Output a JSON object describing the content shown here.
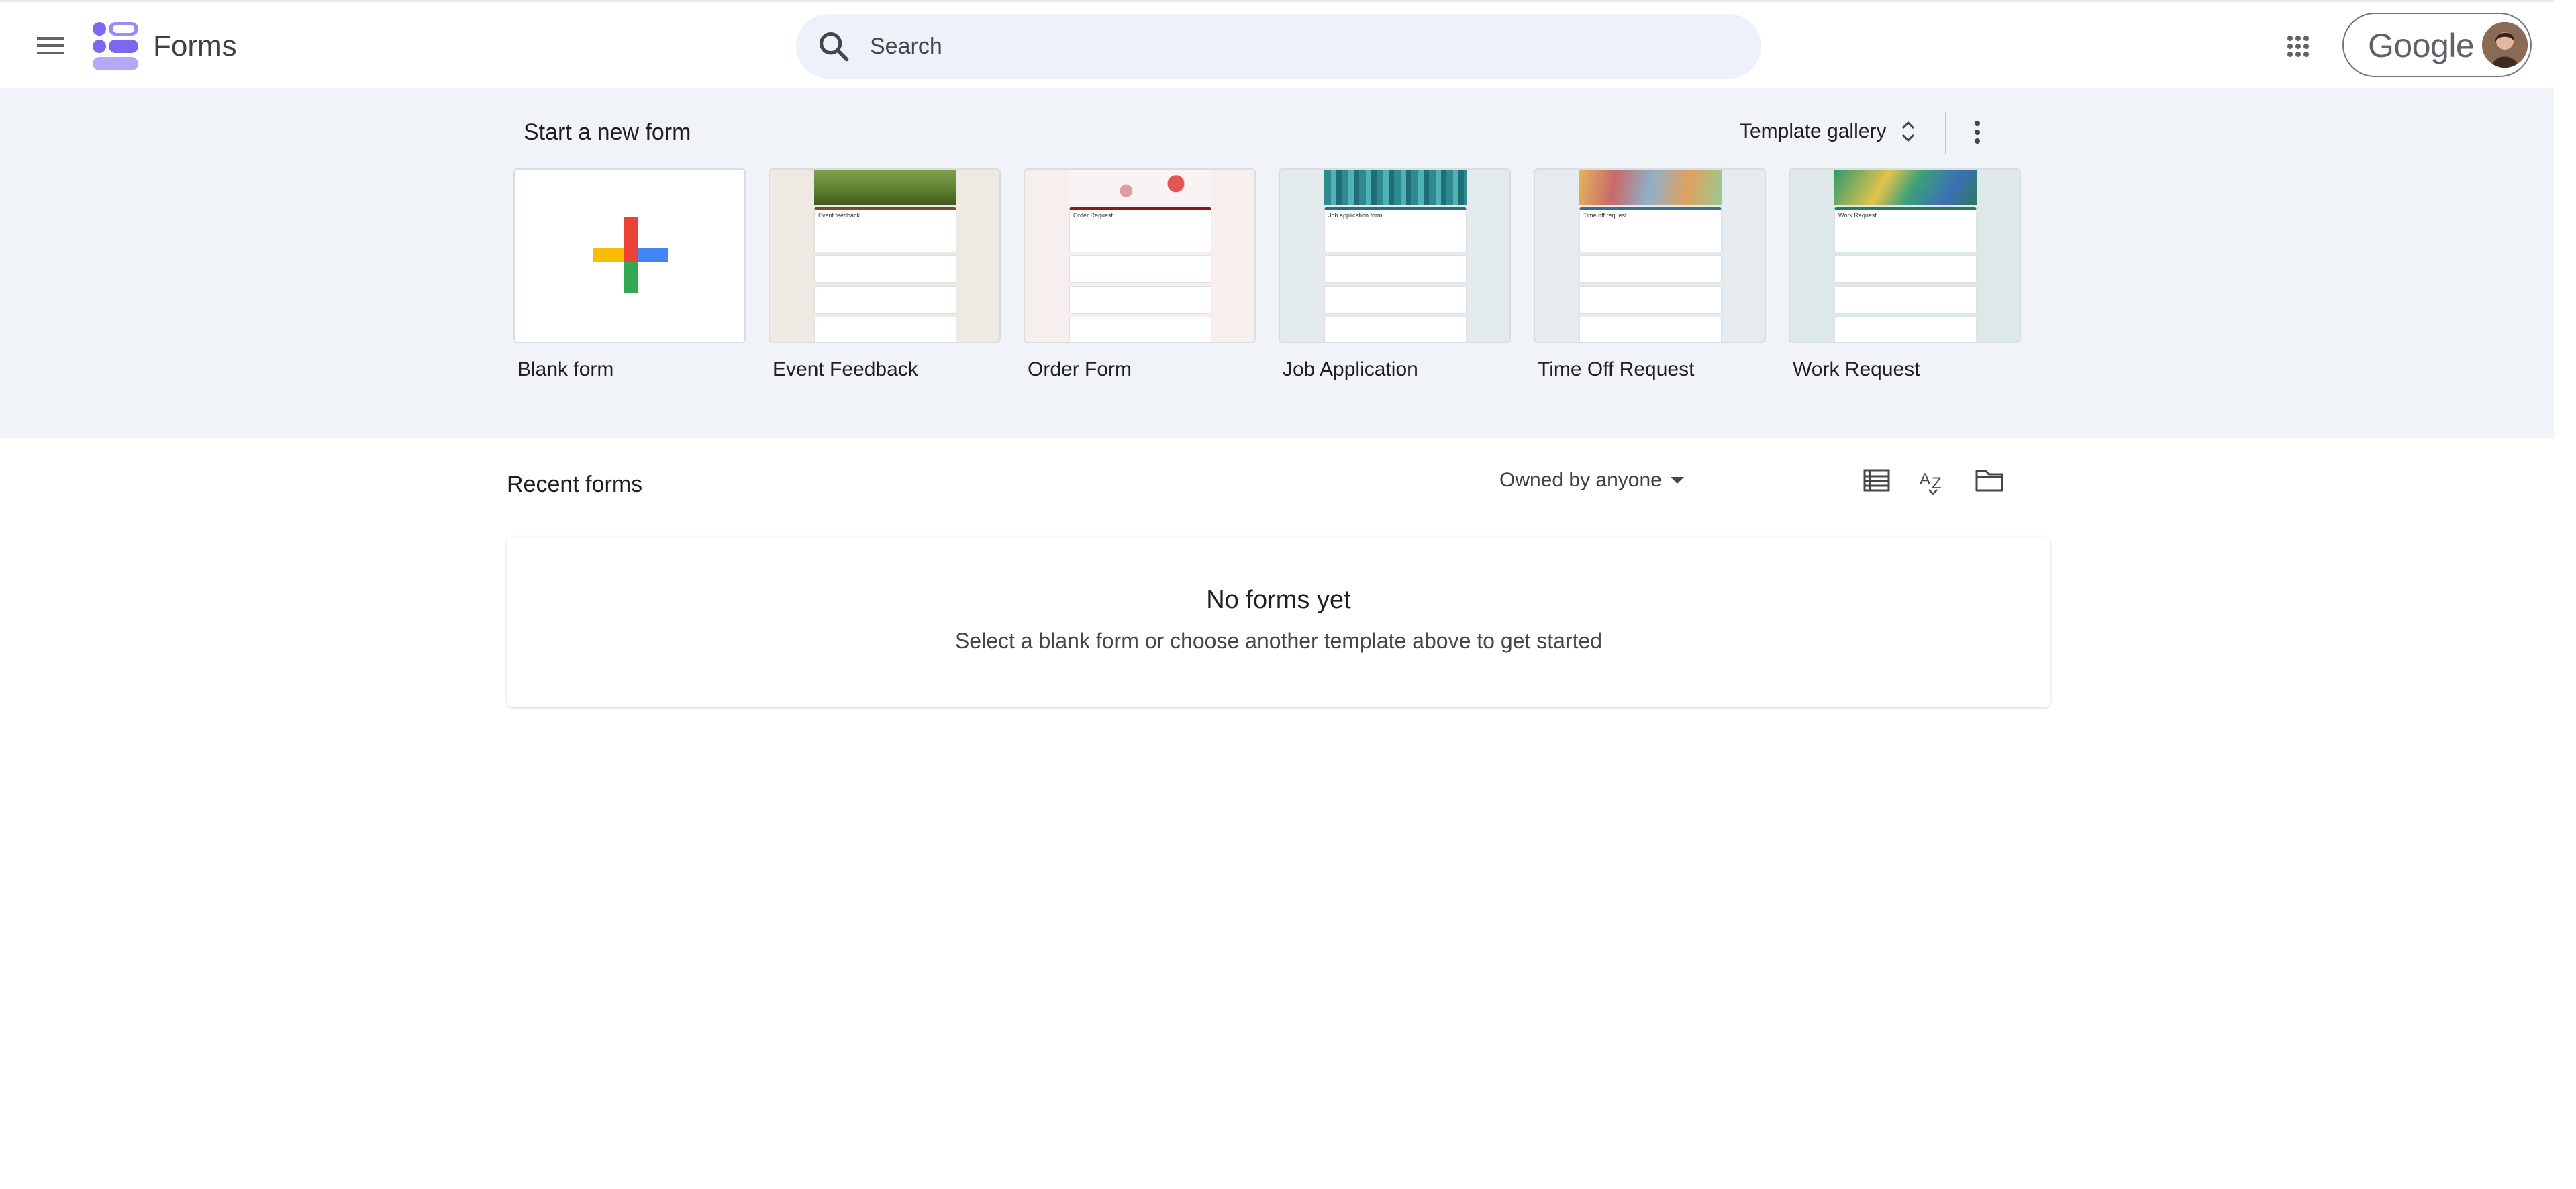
{
  "header": {
    "menu_icon": "hamburger-menu-icon",
    "app_title": "Forms",
    "search": {
      "placeholder": "Search"
    },
    "apps_icon": "google-apps-grid-icon",
    "account": {
      "brand": "Google"
    }
  },
  "templates": {
    "section_title": "Start a new form",
    "gallery_label": "Template gallery",
    "items": [
      {
        "label": "Blank form",
        "thumb": "plus"
      },
      {
        "label": "Event Feedback",
        "thumb_title": "Event feedback",
        "accent": "#6f4e37",
        "banner": "#6b8f3a"
      },
      {
        "label": "Order Form",
        "thumb_title": "Order Request",
        "accent": "#8b1a1a",
        "banner": "#f3d6d6"
      },
      {
        "label": "Job Application",
        "thumb_title": "Job application form",
        "accent": "#2e6e72",
        "banner": "#3a9aa0"
      },
      {
        "label": "Time Off Request",
        "thumb_title": "Time off request",
        "accent": "#3f6e8c",
        "banner": "#d9a25a"
      },
      {
        "label": "Work Request",
        "thumb_title": "Work Request",
        "accent": "#2a7a5a",
        "banner": "#3aa07a"
      }
    ]
  },
  "recent": {
    "title": "Recent forms",
    "owner_filter": "Owned by anyone",
    "empty_title": "No forms yet",
    "empty_subtitle": "Select a blank form or choose another template above to get started"
  },
  "colors": {
    "band_bg": "#f0f4f9",
    "search_bg": "#edf2fa",
    "forms_purple": "#7b68ee"
  }
}
